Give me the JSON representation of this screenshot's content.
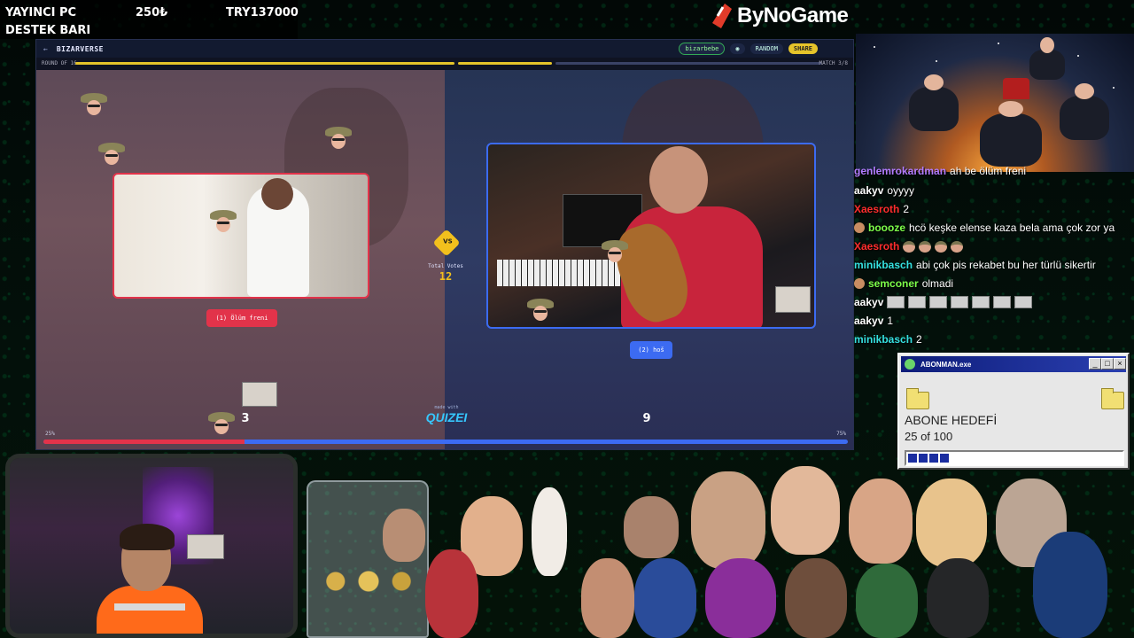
{
  "statbar": {
    "row1_label": "YAYINCI PC",
    "row1_amount": "250₺",
    "row1_goal": "TRY137000",
    "row2_label": "DESTEK BARI"
  },
  "logo": {
    "text": "ByNoGame"
  },
  "quiz": {
    "brand": "BIZARVERSE",
    "back": "←",
    "user_pill": "bizarbebe",
    "random_label": "RANDOM",
    "share_label": "SHARE",
    "round_label": "ROUND OF 16",
    "match_label": "MATCH 3/8",
    "vs": "VS",
    "total_votes_label": "Total Votes",
    "total_votes": "12",
    "left_option": "(1) Ölüm freni",
    "right_option": "(2) hoš",
    "left_count": "3",
    "right_count": "9",
    "made_with": "made with",
    "quizei": "QUIZEI",
    "left_pct_label": "25%",
    "right_pct_label": "75%",
    "left_share": 0.25
  },
  "chat": [
    {
      "user": "genlemrokardman",
      "color": "#b37cff",
      "msg": "ah be ölüm freni"
    },
    {
      "user": "aakyv",
      "color": "#ffffff",
      "msg": "oyyyy"
    },
    {
      "user": "Xaesroth",
      "color": "#ff2d2d",
      "msg": "2"
    },
    {
      "user": "boooze",
      "color": "#7dff4a",
      "msg": "hcö keşke elense kaza bela ama çok zor ya"
    },
    {
      "user": "Xaesroth",
      "color": "#ff2d2d",
      "msg": ""
    },
    {
      "user": "minikbasch",
      "color": "#35e0e0",
      "msg": "abi çok pis rekabet bu her türlü sikertir"
    },
    {
      "user": "semconer",
      "color": "#7dff4a",
      "msg": "olmadi"
    },
    {
      "user": "aakyv",
      "color": "#ffffff",
      "msg": ""
    },
    {
      "user": "aakyv",
      "color": "#ffffff",
      "msg": "1"
    },
    {
      "user": "minikbasch",
      "color": "#35e0e0",
      "msg": "2"
    }
  ],
  "goal_window": {
    "title": "ABONMAN.exe",
    "heading": "ABONE HEDEFİ",
    "progress_text": "25 of 100",
    "progress": 0.25,
    "min": "_",
    "max": "□",
    "close": "×"
  }
}
